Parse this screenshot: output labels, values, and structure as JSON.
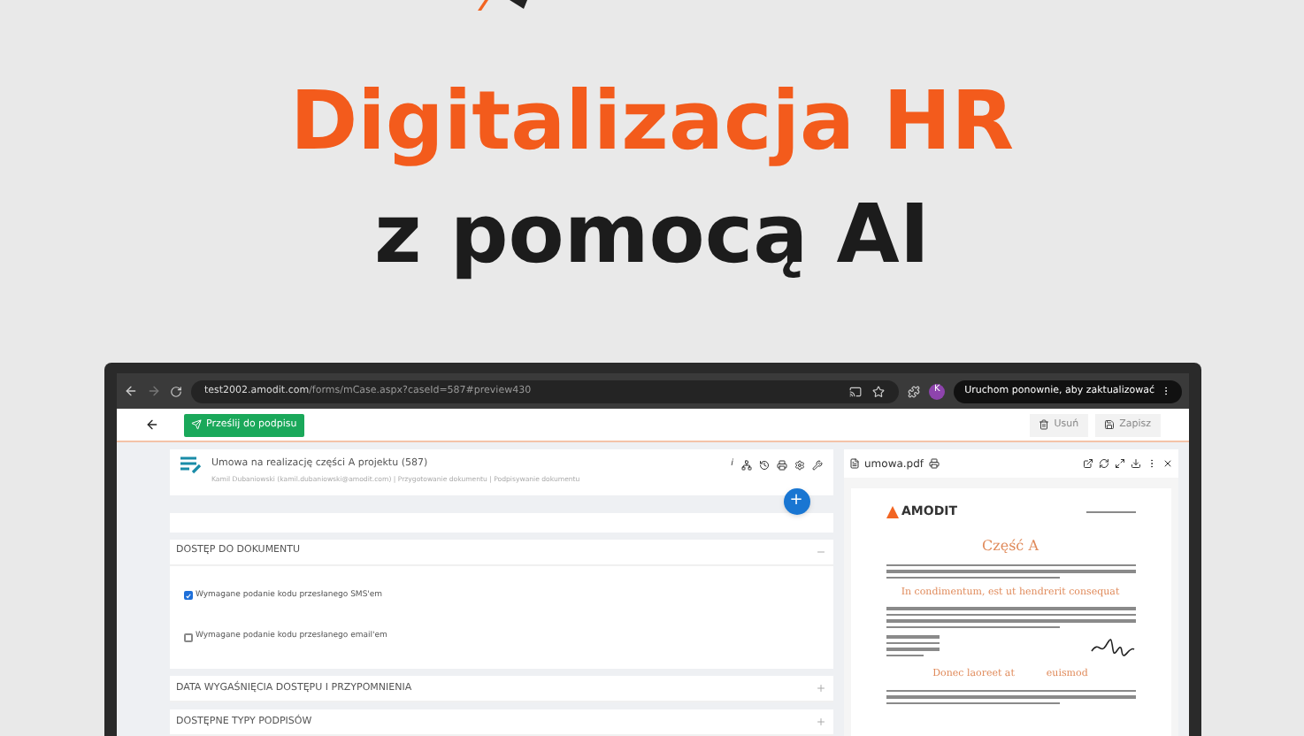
{
  "headline": {
    "line_1": "Digitalizacja HR",
    "line_2": "z pomocą AI"
  },
  "browser": {
    "url_host": "test2002.amodit.com",
    "url_path": "/forms/mCase.aspx?caseId=587#preview430",
    "avatar": "K",
    "update_button": "Uruchom ponownie, aby zaktualizować"
  },
  "toolbar": {
    "send_button": "Prześlij do podpisu",
    "delete_button": "Usuń",
    "save_button": "Zapisz"
  },
  "case_card": {
    "title": "Umowa na realizację części A projektu (587)",
    "subtitle": "Kamil Dubaniowski (kamil.dubaniowski@amodit.com) | Przygotowanie dokumentu | Podpisywanie dokumentu",
    "info_icon": "i",
    "add_button": "+"
  },
  "sections": [
    {
      "title": "DOSTĘP DO DOKUMENTU",
      "expanded": true,
      "options": [
        {
          "label": "Wymagane podanie kodu przesłanego SMS'em",
          "checked": true
        },
        {
          "label": "Wymagane podanie kodu przesłanego email'em",
          "checked": false
        }
      ]
    },
    {
      "title": "DATA WYGAŚNIĘCIA DOSTĘPU I PRZYPOMNIENIA",
      "expanded": false
    },
    {
      "title": "DOSTĘPNE TYPY PODPISÓW",
      "expanded": false
    }
  ],
  "pdf_viewer": {
    "filename": "umowa.pdf",
    "logo": "AMODIT",
    "heading": "Część A",
    "subheading_1": "In condimentum, est ut hendrerit consequat",
    "subheading_2": "Donec laoreet at",
    "subheading_2_end": "euismod"
  }
}
